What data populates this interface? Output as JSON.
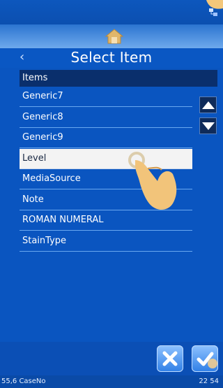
{
  "title": "Select Item",
  "list_header": "Items",
  "items": [
    {
      "label": "Generic7",
      "selected": false
    },
    {
      "label": "Generic8",
      "selected": false
    },
    {
      "label": "Generic9",
      "selected": false
    },
    {
      "label": "Level",
      "selected": true
    },
    {
      "label": "MediaSource",
      "selected": false
    },
    {
      "label": "Note",
      "selected": false
    },
    {
      "label": "ROMAN NUMERAL",
      "selected": false
    },
    {
      "label": "StainType",
      "selected": false
    }
  ],
  "status": {
    "left": "55,6 CaseNo",
    "right": "22 54"
  },
  "colors": {
    "background": "#0a55c0",
    "header": "#0a2f6c",
    "selected_row": "#f3f3f3"
  },
  "icons": [
    "network-icon",
    "home-icon",
    "back-arrow-icon",
    "scroll-up-icon",
    "scroll-down-icon",
    "cancel-icon",
    "confirm-icon",
    "pointer-hand-icon"
  ]
}
